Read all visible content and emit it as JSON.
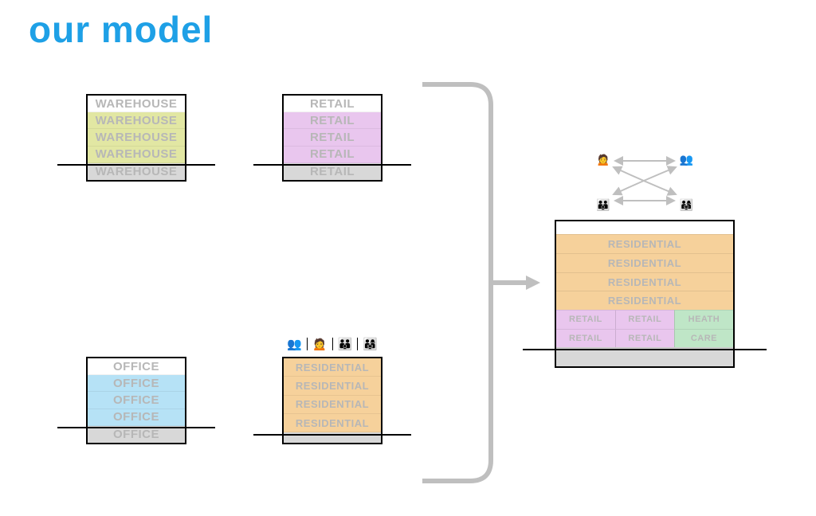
{
  "title": "our model",
  "blocks": {
    "warehouse": {
      "label": "WAREHOUSE",
      "rows": 5,
      "color": "c-wh"
    },
    "retail": {
      "label": "RETAIL",
      "rows": 5,
      "color": "c-rt"
    },
    "office": {
      "label": "OFFICE",
      "rows": 5,
      "color": "c-of"
    },
    "residential": {
      "label": "RESIDENTIAL",
      "rows": 4,
      "color": "c-re"
    }
  },
  "mixed": {
    "residential_label": "RESIDENTIAL",
    "retail_label": "RETAIL",
    "health_label_top": "HEATH",
    "health_label_bottom": "CARE"
  },
  "icons": {
    "person": "👤",
    "pair": "👥",
    "family": "👨‍👩‍👧",
    "group": "👪",
    "single": "🙍"
  }
}
